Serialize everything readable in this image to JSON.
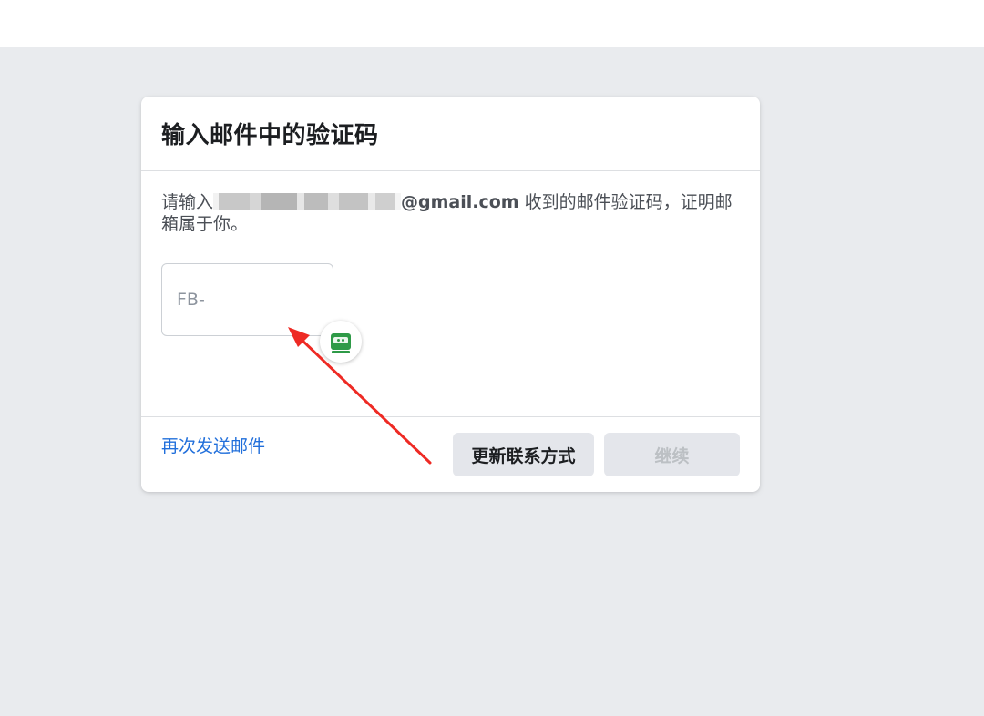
{
  "dialog": {
    "title": "输入邮件中的验证码",
    "instruction_prefix": "请输入",
    "email_suffix": "@gmail.com",
    "instruction_suffix": " 收到的邮件验证码，证明邮箱属于你。",
    "code_input": {
      "placeholder": "FB-",
      "value": ""
    },
    "extension_icon": "robot-icon",
    "resend_link": "再次发送邮件",
    "buttons": {
      "update_contact": "更新联系方式",
      "continue": "继续"
    }
  },
  "colors": {
    "page_background": "#e9ebee",
    "link": "#216fdb",
    "annotation_arrow": "#ee2a24",
    "extension_green": "#2e9a47"
  }
}
